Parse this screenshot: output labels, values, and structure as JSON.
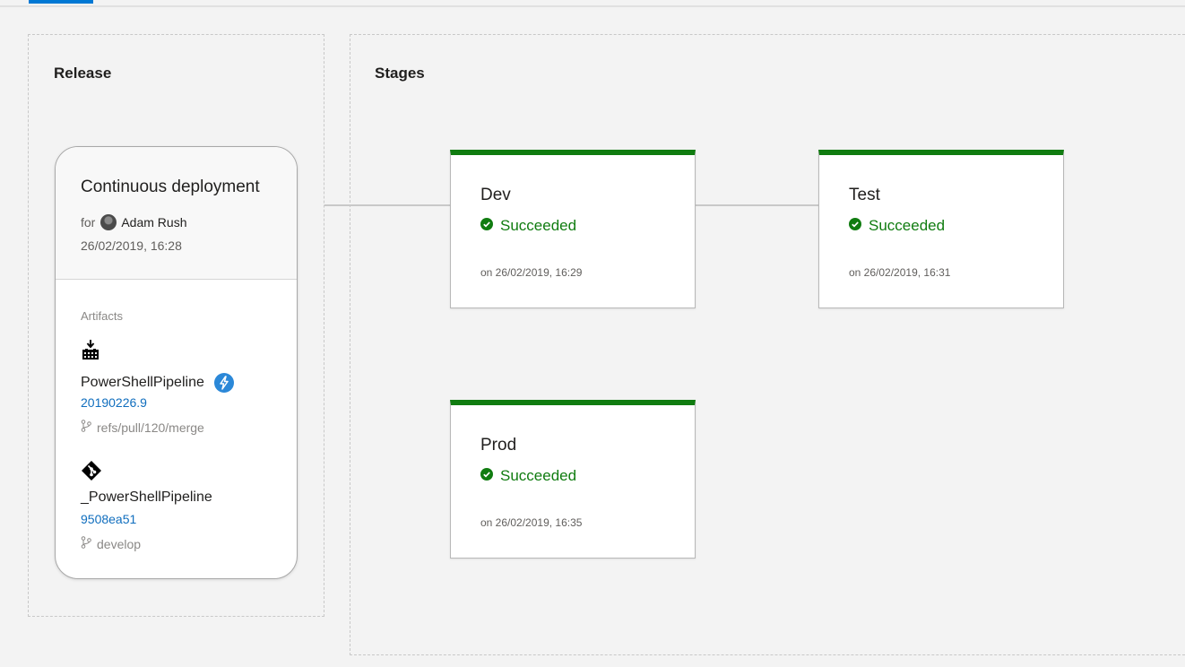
{
  "release_panel": {
    "title": "Release"
  },
  "stages_panel": {
    "title": "Stages"
  },
  "release_card": {
    "title": "Continuous deployment",
    "for_label": "for",
    "author": "Adam Rush",
    "date": "26/02/2019, 16:28",
    "artifacts_label": "Artifacts",
    "artifacts": [
      {
        "name": "PowerShellPipeline",
        "version": "20190226.9",
        "branch": "refs/pull/120/merge",
        "icon": "build-artifact-icon",
        "has_trigger": true
      },
      {
        "name": "_PowerShellPipeline",
        "version": "9508ea51",
        "branch": "develop",
        "icon": "git-icon",
        "has_trigger": false
      }
    ]
  },
  "stages": [
    {
      "name": "Dev",
      "status": "Succeeded",
      "time": "on 26/02/2019, 16:29"
    },
    {
      "name": "Test",
      "status": "Succeeded",
      "time": "on 26/02/2019, 16:31"
    },
    {
      "name": "Prod",
      "status": "Succeeded",
      "time": "on 26/02/2019, 16:35"
    }
  ],
  "colors": {
    "success": "#107c10",
    "link": "#106ebe",
    "accent": "#0078d4",
    "trigger": "#2b88d8"
  }
}
